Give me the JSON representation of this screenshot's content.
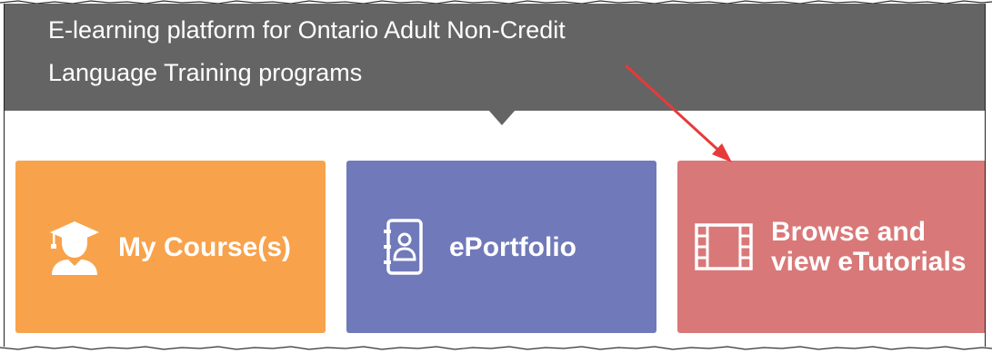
{
  "banner": {
    "text_line1": "E-learning platform for Ontario Adult Non-Credit",
    "text_line2": "Language Training programs",
    "background": "#646464"
  },
  "tiles": [
    {
      "label": "My Course(s)",
      "icon": "graduate-icon",
      "color": "#f8a24b"
    },
    {
      "label": "ePortfolio",
      "icon": "contact-book-icon",
      "color": "#7079b9"
    },
    {
      "label": "Browse and\nview eTutorials",
      "icon": "film-strip-icon",
      "color": "#d97878"
    }
  ],
  "annotation": {
    "arrow_color": "#e83a3a",
    "arrow_target": "tile-browse-etutorials"
  }
}
